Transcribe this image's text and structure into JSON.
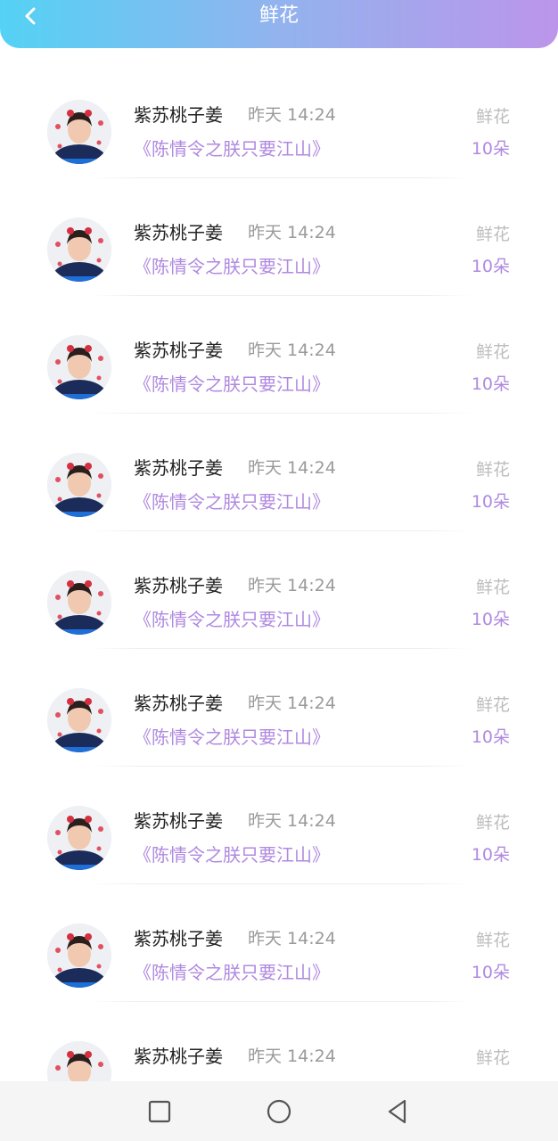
{
  "header": {
    "title": "鲜花",
    "back_icon": "chevron-left-icon",
    "gradient": [
      "#54d2f5",
      "#bc95ea"
    ]
  },
  "records": [
    {
      "user": "紫苏桃子姜",
      "time": "昨天 14:24",
      "book": "《陈情令之朕只要江山》",
      "gift_label": "鲜花",
      "gift_count": "10朵"
    },
    {
      "user": "紫苏桃子姜",
      "time": "昨天 14:24",
      "book": "《陈情令之朕只要江山》",
      "gift_label": "鲜花",
      "gift_count": "10朵"
    },
    {
      "user": "紫苏桃子姜",
      "time": "昨天 14:24",
      "book": "《陈情令之朕只要江山》",
      "gift_label": "鲜花",
      "gift_count": "10朵"
    },
    {
      "user": "紫苏桃子姜",
      "time": "昨天 14:24",
      "book": "《陈情令之朕只要江山》",
      "gift_label": "鲜花",
      "gift_count": "10朵"
    },
    {
      "user": "紫苏桃子姜",
      "time": "昨天 14:24",
      "book": "《陈情令之朕只要江山》",
      "gift_label": "鲜花",
      "gift_count": "10朵"
    },
    {
      "user": "紫苏桃子姜",
      "time": "昨天 14:24",
      "book": "《陈情令之朕只要江山》",
      "gift_label": "鲜花",
      "gift_count": "10朵"
    },
    {
      "user": "紫苏桃子姜",
      "time": "昨天 14:24",
      "book": "《陈情令之朕只要江山》",
      "gift_label": "鲜花",
      "gift_count": "10朵"
    },
    {
      "user": "紫苏桃子姜",
      "time": "昨天 14:24",
      "book": "《陈情令之朕只要江山》",
      "gift_label": "鲜花",
      "gift_count": "10朵"
    },
    {
      "user": "紫苏桃子姜",
      "time": "昨天 14:24",
      "book": "",
      "gift_label": "鲜花",
      "gift_count": ""
    }
  ],
  "colors": {
    "accent": "#b089e0",
    "name": "#222222",
    "muted": "#9a9a9a",
    "label": "#bdbdbd"
  },
  "navbar": {
    "icons": [
      "square-recents-icon",
      "circle-home-icon",
      "triangle-back-icon"
    ]
  }
}
